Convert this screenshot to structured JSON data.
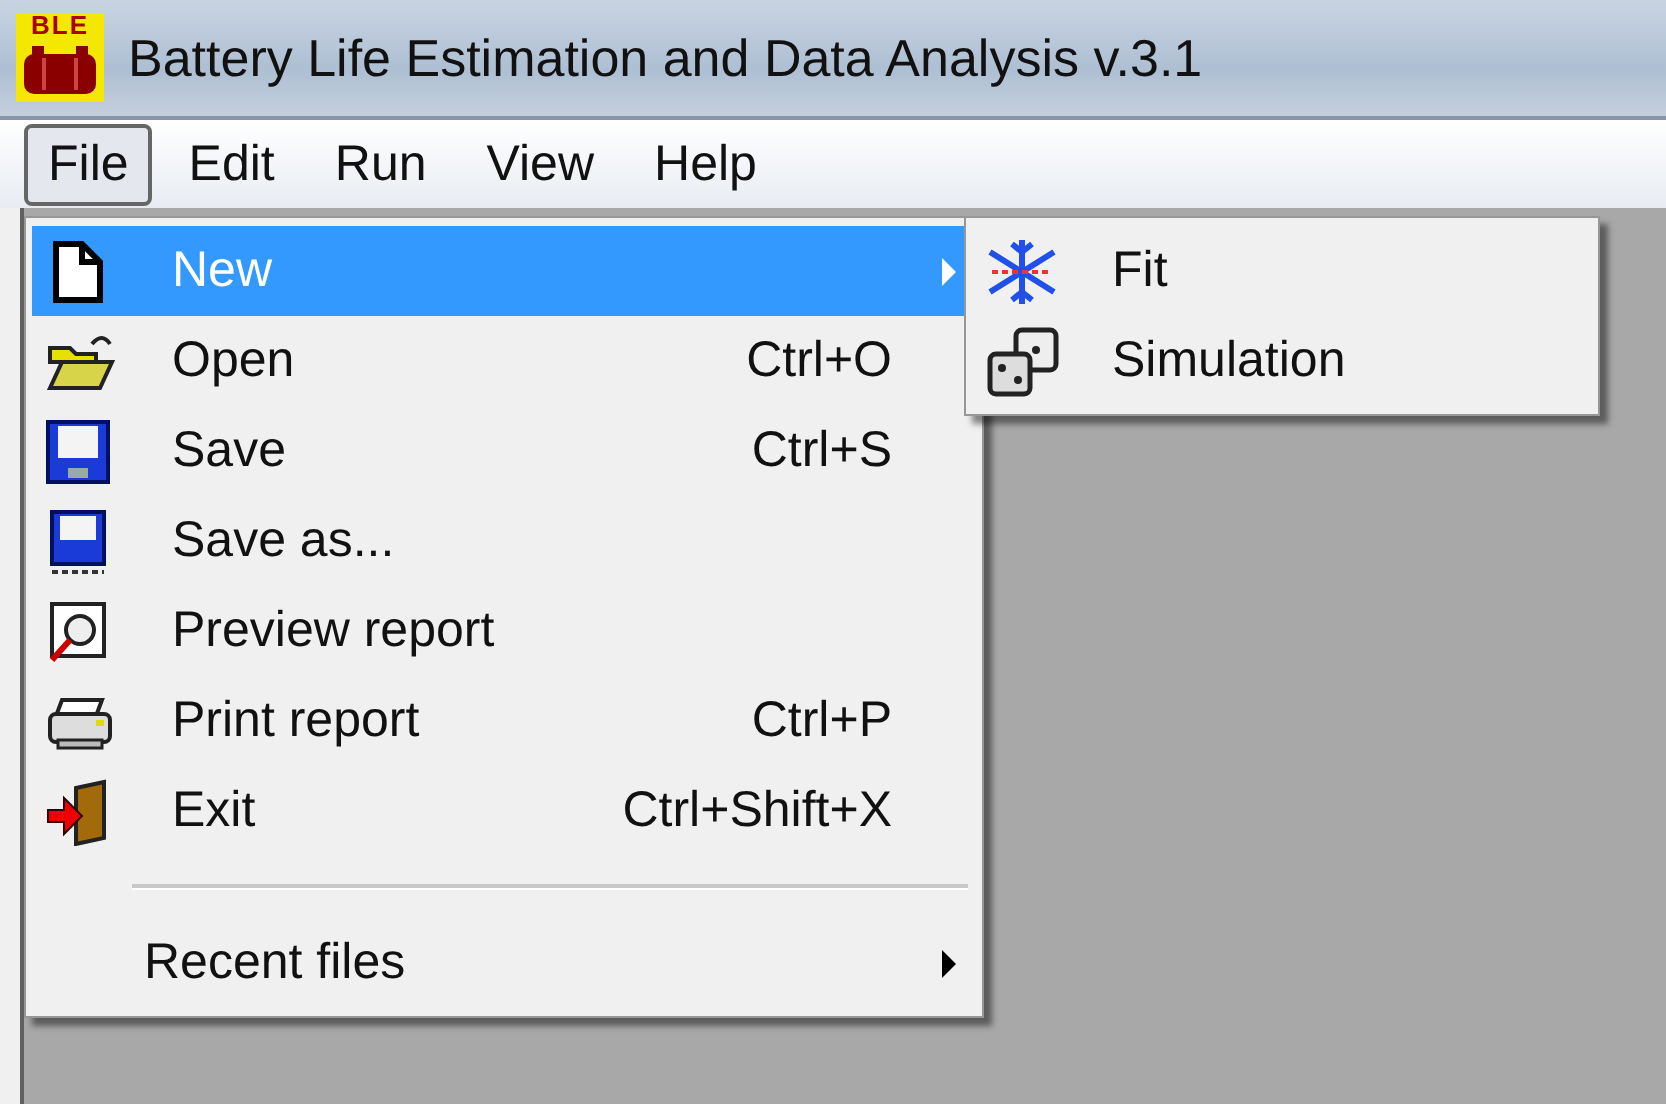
{
  "window": {
    "title": "Battery Life Estimation and Data Analysis v.3.1",
    "logo": "BLE"
  },
  "menubar": [
    {
      "label": "File",
      "selected": true
    },
    {
      "label": "Edit",
      "selected": false
    },
    {
      "label": "Run",
      "selected": false
    },
    {
      "label": "View",
      "selected": false
    },
    {
      "label": "Help",
      "selected": false
    }
  ],
  "file_menu": [
    {
      "kind": "submenu",
      "label": "New",
      "selected": true
    },
    {
      "kind": "command",
      "label": "Open",
      "shortcut": "Ctrl+O",
      "selected": false
    },
    {
      "kind": "command",
      "label": "Save",
      "shortcut": "Ctrl+S",
      "selected": false
    },
    {
      "kind": "command",
      "label": "Save as...",
      "selected": false
    },
    {
      "kind": "command",
      "label": "Preview report",
      "selected": false
    },
    {
      "kind": "command",
      "label": "Print report",
      "shortcut": "Ctrl+P",
      "selected": false
    },
    {
      "kind": "command",
      "label": "Exit",
      "shortcut": "Ctrl+Shift+X",
      "selected": false
    },
    {
      "kind": "separator"
    },
    {
      "kind": "submenu",
      "label": "Recent files",
      "selected": false
    }
  ],
  "new_submenu": [
    {
      "label": "Fit",
      "selected": false
    },
    {
      "label": "Simulation",
      "selected": false
    }
  ]
}
